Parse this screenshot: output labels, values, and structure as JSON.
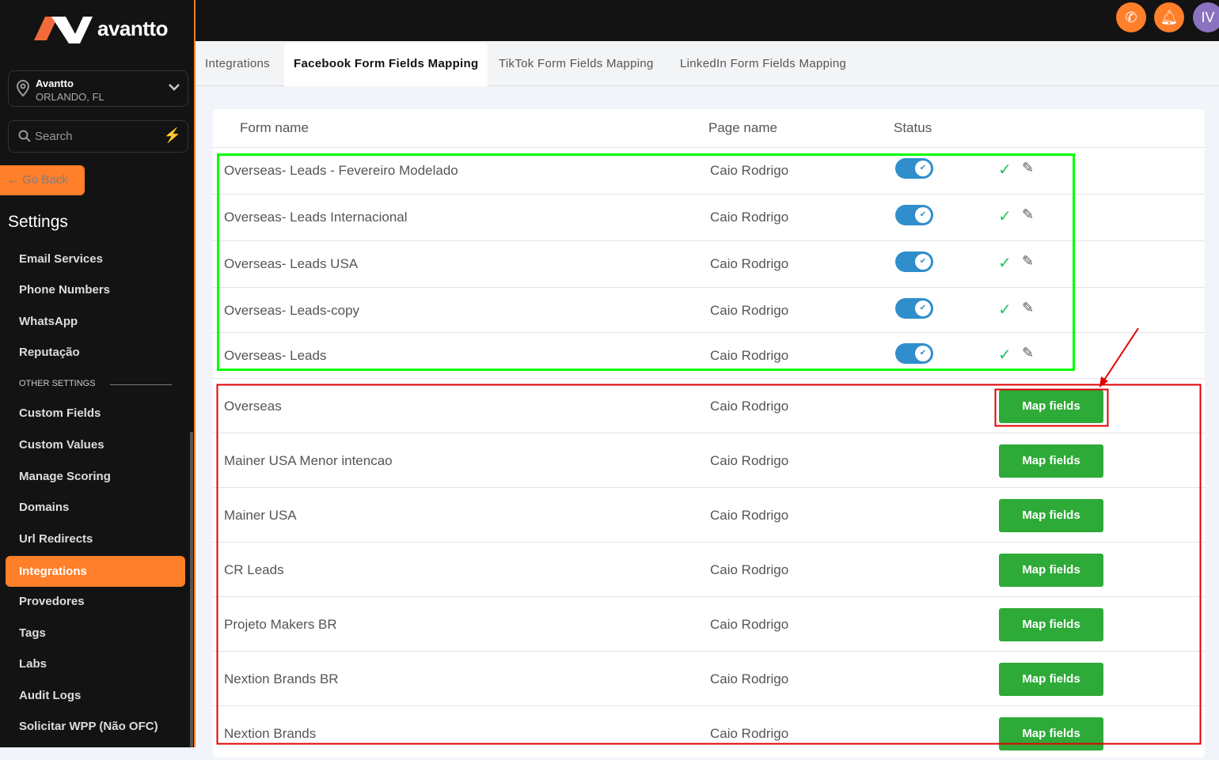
{
  "brand": {
    "name": "avantto"
  },
  "location": {
    "name": "Avantto",
    "city": "ORLANDO, FL"
  },
  "search": {
    "placeholder": "Search"
  },
  "go_back": "← Go Back",
  "settings_title": "Settings",
  "nav": [
    "Email Services",
    "Phone Numbers",
    "WhatsApp",
    "Reputação"
  ],
  "other_settings": "OTHER SETTINGS",
  "nav2": [
    "Custom Fields",
    "Custom Values",
    "Manage Scoring",
    "Domains",
    "Url Redirects"
  ],
  "nav_active": "Integrations",
  "nav3": [
    "Provedores",
    "Tags",
    "Labs",
    "Audit Logs",
    "Solicitar WPP (Não OFC)"
  ],
  "avatar": "IV",
  "tabs": [
    "Integrations",
    "Facebook Form Fields Mapping",
    "TikTok Form Fields Mapping",
    "LinkedIn Form Fields Mapping"
  ],
  "table": {
    "headers": [
      "Form name",
      "Page name",
      "Status"
    ],
    "mapped": [
      {
        "form": "Overseas- Leads - Fevereiro Modelado",
        "page": "Caio Rodrigo"
      },
      {
        "form": "Overseas- Leads Internacional",
        "page": "Caio Rodrigo"
      },
      {
        "form": "Overseas- Leads USA",
        "page": "Caio Rodrigo"
      },
      {
        "form": "Overseas- Leads-copy",
        "page": "Caio Rodrigo"
      },
      {
        "form": "Overseas- Leads",
        "page": "Caio Rodrigo"
      }
    ],
    "unmapped": [
      {
        "form": "Overseas",
        "page": "Caio Rodrigo"
      },
      {
        "form": "Mainer USA Menor intencao",
        "page": "Caio Rodrigo"
      },
      {
        "form": "Mainer USA",
        "page": "Caio Rodrigo"
      },
      {
        "form": "CR Leads",
        "page": "Caio Rodrigo"
      },
      {
        "form": "Projeto Makers BR",
        "page": "Caio Rodrigo"
      },
      {
        "form": "Nextion Brands BR",
        "page": "Caio Rodrigo"
      },
      {
        "form": "Nextion Brands",
        "page": "Caio Rodrigo"
      }
    ],
    "map_label": "Map fields"
  },
  "colors": {
    "accent": "#ff7f2a",
    "button": "#2eaa38",
    "toggle": "#2f8ecb"
  }
}
